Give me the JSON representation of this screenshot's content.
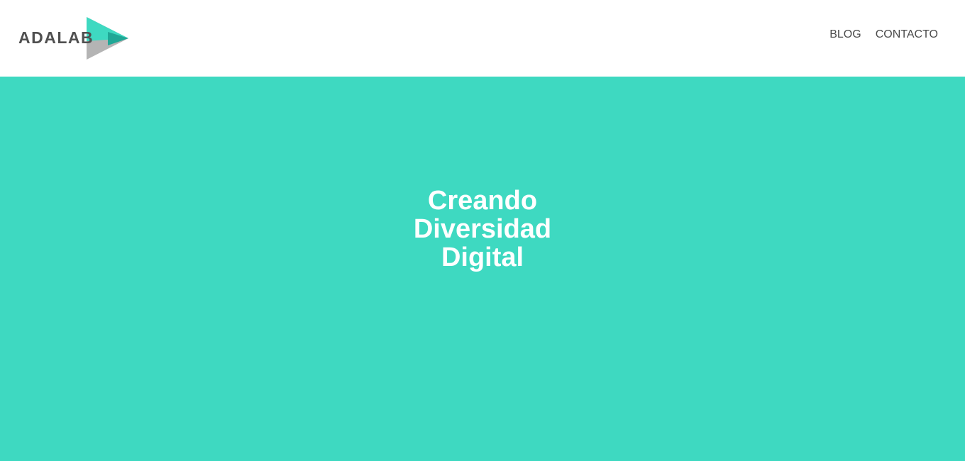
{
  "header": {
    "logo_text": "ADALAB",
    "nav": [
      {
        "label": "BLOG"
      },
      {
        "label": "CONTACTO"
      }
    ]
  },
  "hero": {
    "title_lines": [
      "Creando",
      "Diversidad",
      "Digital"
    ]
  },
  "colors": {
    "brand_teal": "#3ed9c1",
    "logo_dark_teal": "#20a796",
    "logo_gray": "#b4b4b4",
    "text_dark": "#505050",
    "nav_text": "#4a4a4a",
    "hero_text": "#ffffff"
  }
}
